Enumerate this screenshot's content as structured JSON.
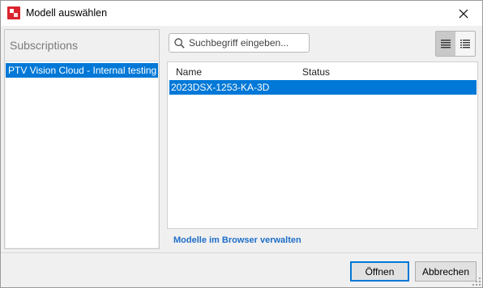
{
  "window": {
    "title": "Modell auswählen",
    "icon": "ptv-app-icon",
    "close_icon": "close-icon"
  },
  "subscriptions": {
    "header": "Subscriptions",
    "items": [
      {
        "label": "PTV Vision Cloud - Internal testing",
        "selected": true
      }
    ]
  },
  "search": {
    "placeholder": "Suchbegriff eingeben...",
    "value": ""
  },
  "view_toggle": {
    "options": [
      "list-view-icon",
      "detail-view-icon"
    ],
    "active": "list-view-icon"
  },
  "models_table": {
    "columns": [
      "Name",
      "Status"
    ],
    "rows": [
      {
        "name": "2023DSX-1253-KA-3D",
        "status": "",
        "selected": true
      }
    ]
  },
  "manage_link": "Modelle im Browser verwalten",
  "buttons": {
    "open": "Öffnen",
    "cancel": "Abbrechen"
  },
  "colors": {
    "selection": "#0078d7",
    "link": "#1e6ec8",
    "app_icon": "#d9232e"
  }
}
